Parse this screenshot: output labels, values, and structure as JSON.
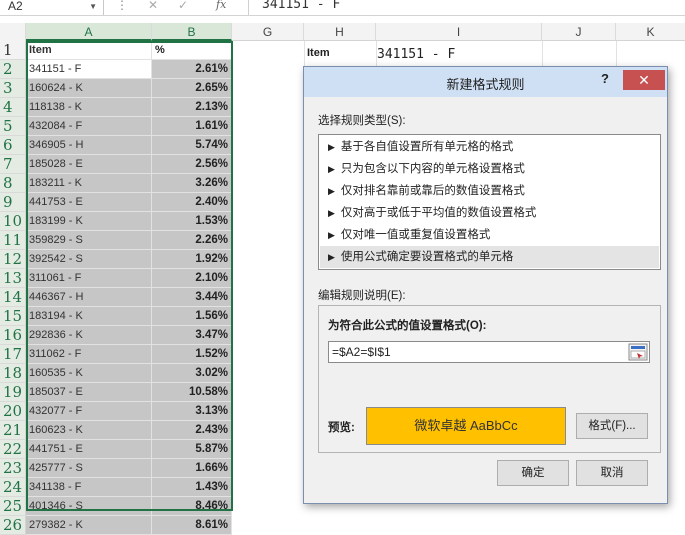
{
  "formula_bar": {
    "name_box": "A2",
    "name_dropdown": "▼",
    "dots": "⋮",
    "cancel_icon": "✕",
    "enter_icon": "✓",
    "fx": "fx",
    "content": "341151 - F"
  },
  "columns": [
    "A",
    "B",
    "G",
    "H",
    "I",
    "J",
    "K"
  ],
  "headers": {
    "a": "Item",
    "b": "%",
    "h": "Item",
    "i": "341151 - F"
  },
  "rows": [
    {
      "num": "1"
    },
    {
      "num": "2",
      "item": "341151 - F",
      "pct": "2.61%"
    },
    {
      "num": "3",
      "item": "160624 - K",
      "pct": "2.65%"
    },
    {
      "num": "4",
      "item": "118138 - K",
      "pct": "2.13%"
    },
    {
      "num": "5",
      "item": "432084 - F",
      "pct": "1.61%"
    },
    {
      "num": "6",
      "item": "346905 - H",
      "pct": "5.74%"
    },
    {
      "num": "7",
      "item": "185028 - E",
      "pct": "2.56%"
    },
    {
      "num": "8",
      "item": "183211 - K",
      "pct": "3.26%"
    },
    {
      "num": "9",
      "item": "441753 - E",
      "pct": "2.40%"
    },
    {
      "num": "10",
      "item": "183199 - K",
      "pct": "1.53%"
    },
    {
      "num": "11",
      "item": "359829 - S",
      "pct": "2.26%"
    },
    {
      "num": "12",
      "item": "392542 - S",
      "pct": "1.92%"
    },
    {
      "num": "13",
      "item": "311061 - F",
      "pct": "2.10%"
    },
    {
      "num": "14",
      "item": "446367 - H",
      "pct": "3.44%"
    },
    {
      "num": "15",
      "item": "183194 - K",
      "pct": "1.56%"
    },
    {
      "num": "16",
      "item": "292836 - K",
      "pct": "3.47%"
    },
    {
      "num": "17",
      "item": "311062 - F",
      "pct": "1.52%"
    },
    {
      "num": "18",
      "item": "160535 - K",
      "pct": "3.02%"
    },
    {
      "num": "19",
      "item": "185037 - E",
      "pct": "10.58%"
    },
    {
      "num": "20",
      "item": "432077 - F",
      "pct": "3.13%"
    },
    {
      "num": "21",
      "item": "160623 - K",
      "pct": "2.43%"
    },
    {
      "num": "22",
      "item": "441751 - E",
      "pct": "5.87%"
    },
    {
      "num": "23",
      "item": "425777 - S",
      "pct": "1.66%"
    },
    {
      "num": "24",
      "item": "341138 - F",
      "pct": "1.43%"
    },
    {
      "num": "25",
      "item": "401346 - S",
      "pct": "8.46%"
    },
    {
      "num": "26",
      "item": "279382 - K",
      "pct": "8.61%"
    }
  ],
  "dialog": {
    "title": "新建格式规则",
    "help": "?",
    "close": "✕",
    "select_type_label": "选择规则类型(S):",
    "rule_types": [
      "基于各自值设置所有单元格的格式",
      "只为包含以下内容的单元格设置格式",
      "仅对排名靠前或靠后的数值设置格式",
      "仅对高于或低于平均值的数值设置格式",
      "仅对唯一值或重复值设置格式",
      "使用公式确定要设置格式的单元格"
    ],
    "selected_rule_index": 5,
    "edit_desc_label": "编辑规则说明(E):",
    "formula_label": "为符合此公式的值设置格式(O):",
    "formula_value": "=$A2=$I$1",
    "preview_label": "预览:",
    "preview_text": "微软卓越  AaBbCc",
    "preview_color": "#FFC000",
    "format_button": "格式(F)...",
    "ok_button": "确定",
    "cancel_button": "取消"
  }
}
